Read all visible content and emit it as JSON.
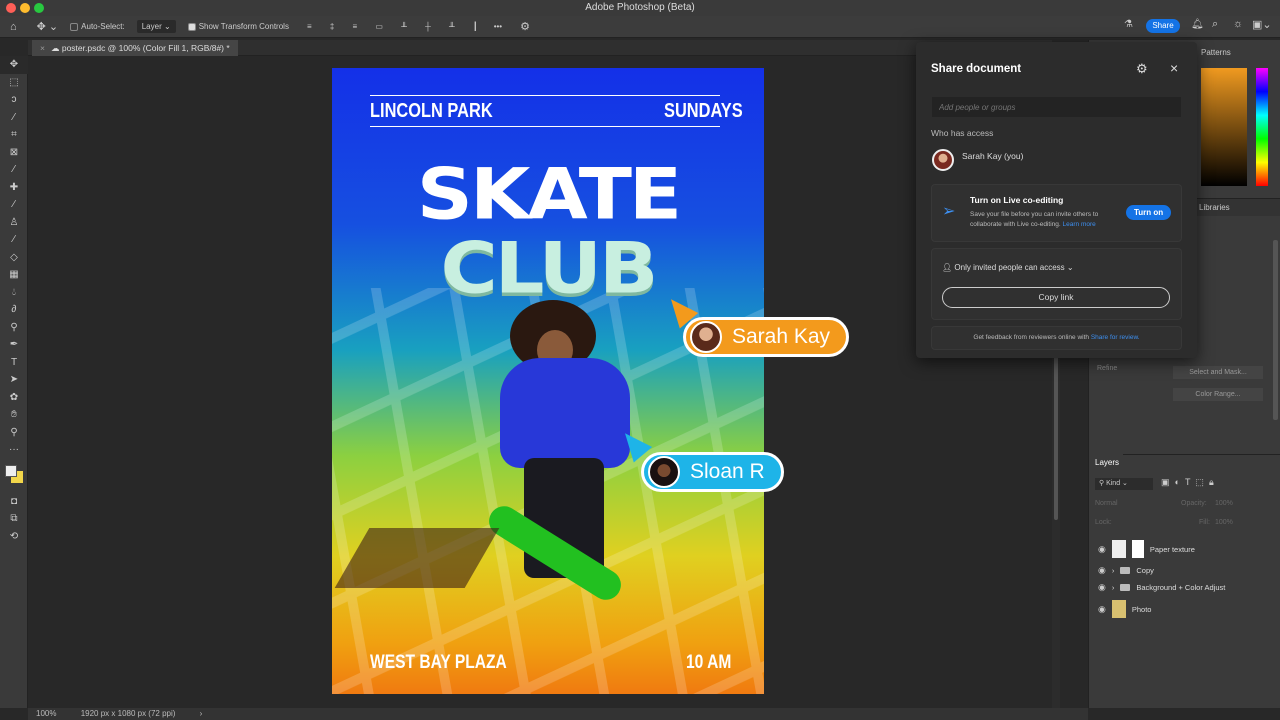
{
  "window": {
    "title": "Adobe Photoshop (Beta)"
  },
  "options_bar": {
    "auto_select": "Auto-Select:",
    "layer_select": "Layer",
    "show_transform": "Show Transform Controls",
    "more": "•••"
  },
  "topright": {
    "share": "Share"
  },
  "document_tab": {
    "title": "poster.psdc @ 100% (Color Fill 1, RGB/8#) *"
  },
  "tools": [
    "move",
    "marquee",
    "lasso",
    "magic-wand",
    "crop",
    "frame",
    "eyedropper",
    "healing",
    "brush",
    "stamp",
    "history-brush",
    "eraser",
    "gradient",
    "blur",
    "dodge",
    "pen-freeform",
    "pen",
    "type",
    "path-select",
    "shape",
    "hand",
    "zoom",
    "more"
  ],
  "poster": {
    "top_left": "LINCOLN PARK",
    "top_right": "SUNDAYS",
    "headline1": "SKATE",
    "headline2": "CLUB",
    "bottom_left": "WEST BAY PLAZA",
    "bottom_right": "10 AM"
  },
  "collaborators": [
    {
      "name": "Sarah Kay",
      "color": "#f39a1c"
    },
    {
      "name": "Sloan R",
      "color": "#1eb4e8"
    }
  ],
  "share_panel": {
    "title": "Share document",
    "placeholder": "Add people or groups",
    "who_has_access": "Who has access",
    "user": "Sarah Kay (you)",
    "live_title": "Turn on Live co-editing",
    "live_desc": "Save your file before you can invite others to collaborate with Live co-editing.",
    "learn_more": "Learn more",
    "turn_on": "Turn on",
    "access": "Only invited people can access",
    "copy_link": "Copy link",
    "feedback": "Get feedback from reviewers online with",
    "share_for_review": "Share for review."
  },
  "right_panels": {
    "patterns_tab": "Patterns",
    "libraries_tab": "Libraries",
    "refine": "Refine",
    "select_mask": "Select and Mask...",
    "color_range": "Color Range..."
  },
  "layers": {
    "tab": "Layers",
    "filter": "Kind",
    "blend": "Normal",
    "opacity_label": "Opacity:",
    "opacity": "100%",
    "lock": "Lock:",
    "fill_label": "Fill:",
    "fill": "100%",
    "items": [
      {
        "name": "Paper texture",
        "type": "smart"
      },
      {
        "name": "Copy",
        "type": "group"
      },
      {
        "name": "Background + Color Adjust",
        "type": "group"
      },
      {
        "name": "Photo",
        "type": "image"
      }
    ]
  },
  "status": {
    "zoom": "100%",
    "dimensions": "1920 px x 1080 px (72 ppi)"
  },
  "colors": {
    "accent": "#1473e6"
  }
}
